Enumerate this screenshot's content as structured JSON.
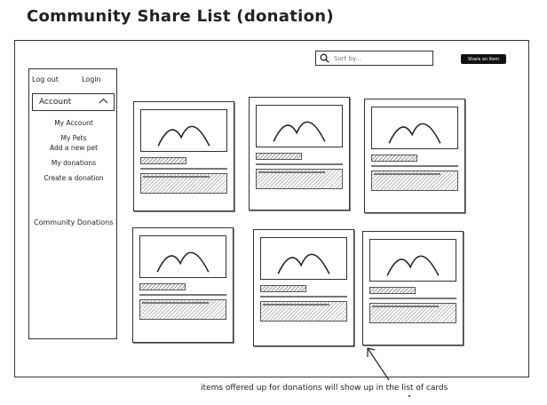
{
  "page": {
    "title": "Community Share List (donation)"
  },
  "search": {
    "placeholder": "Sort by..."
  },
  "header": {
    "share_button_label": "Share an Item"
  },
  "sidebar": {
    "logout_label": "Log out",
    "login_label": "Login",
    "account_label": "Account",
    "items": [
      {
        "label": "My Account"
      },
      {
        "label": "My Pets"
      },
      {
        "label": "Add a new pet"
      },
      {
        "label": "My donations"
      },
      {
        "label": "Create a donation"
      }
    ],
    "community_label": "Community Donations"
  },
  "cards": [
    {
      "image": "mountain-placeholder"
    },
    {
      "image": "mountain-placeholder"
    },
    {
      "image": "mountain-placeholder"
    },
    {
      "image": "mountain-placeholder"
    },
    {
      "image": "mountain-placeholder"
    },
    {
      "image": "mountain-placeholder"
    }
  ],
  "annotation": {
    "text": "items offered up for donations will show up in the list of cards"
  },
  "icons": {
    "search": "search-icon",
    "chevron": "chevron-up-icon",
    "arrow": "arrow-icon"
  }
}
